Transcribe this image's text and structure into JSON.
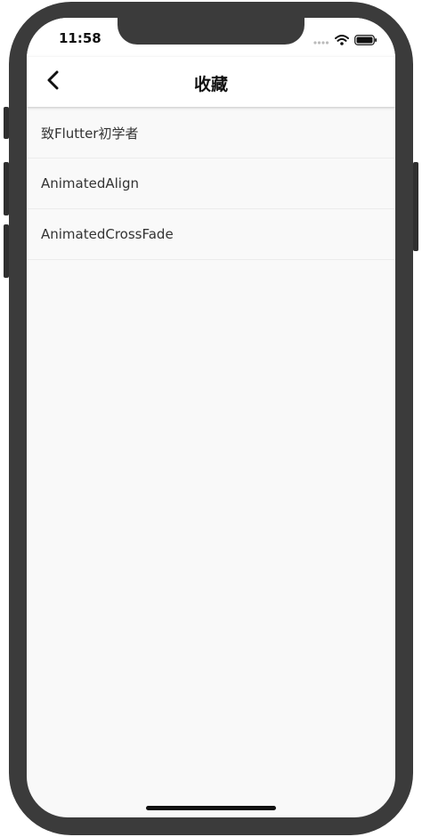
{
  "status_bar": {
    "time": "11:58",
    "icons": [
      "signal-icon",
      "wifi-icon",
      "battery-icon"
    ]
  },
  "app_bar": {
    "title": "收藏",
    "back_icon": "chevron-left-icon"
  },
  "favorites": [
    "致Flutter初学者",
    "AnimatedAlign",
    "AnimatedCrossFade"
  ],
  "colors": {
    "device_frame": "#3b3b3b",
    "background": "#f9f9f9",
    "app_bar": "#ffffff"
  }
}
